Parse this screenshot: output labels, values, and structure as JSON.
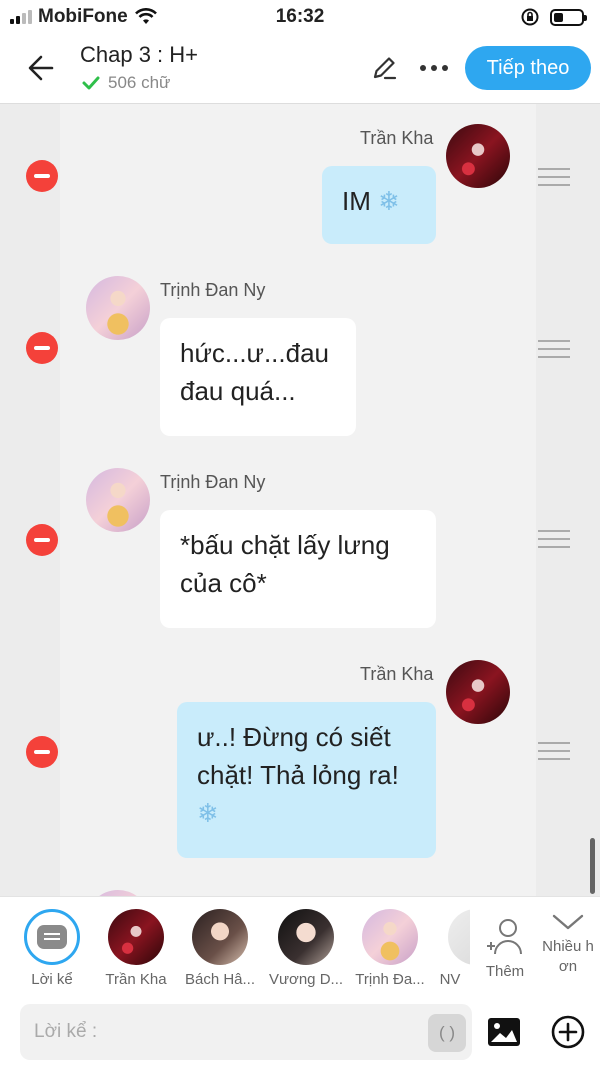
{
  "status_bar": {
    "carrier": "MobiFone",
    "time": "16:32"
  },
  "header": {
    "title": "Chap 3 : H+",
    "word_count": "506 chữ",
    "next_label": "Tiếp theo"
  },
  "messages": [
    {
      "sender": "Trần Kha",
      "side": "right",
      "text": "IM",
      "emoji": "❄"
    },
    {
      "sender": "Trịnh Đan Ny",
      "side": "left",
      "text_lines": [
        "hức...ư...đau",
        "đau quá..."
      ]
    },
    {
      "sender": "Trịnh Đan Ny",
      "side": "left",
      "text_lines": [
        "*bấu chặt lấy lưng",
        "của cô*"
      ]
    },
    {
      "sender": "Trần Kha",
      "side": "right",
      "text_lines": [
        "ư..! Đừng có siết",
        "chặt! Thả lỏng ra!"
      ],
      "emoji": "❄"
    }
  ],
  "characters": [
    {
      "label": "Lời kể",
      "selected": true
    },
    {
      "label": "Trần Kha"
    },
    {
      "label": "Bách Hâ..."
    },
    {
      "label": "Vương D..."
    },
    {
      "label": "Trịnh Đa..."
    },
    {
      "label": "NV"
    }
  ],
  "add_character_label": "Thêm",
  "more_characters_label": [
    "Nhiều h",
    "ơn"
  ],
  "input": {
    "placeholder": "Lời kể :",
    "paren_label": "( )"
  },
  "colors": {
    "accent": "#2ea7f0",
    "delete": "#f4413a",
    "right_bubble": "#c9ecfb",
    "left_bubble": "#ffffff"
  }
}
